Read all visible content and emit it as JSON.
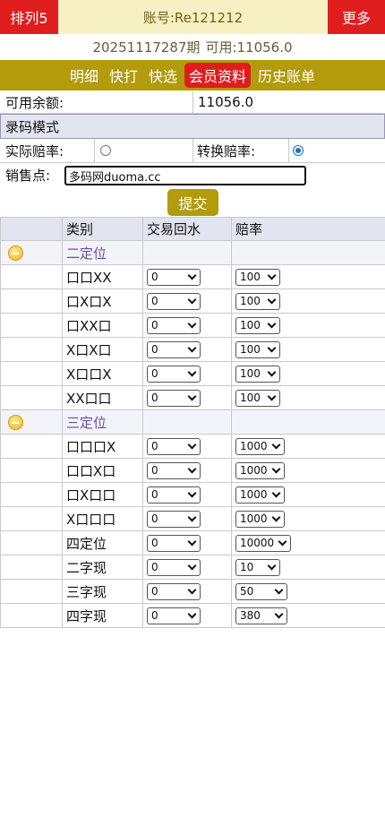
{
  "header": {
    "left_button": "排列5",
    "account": "账号:Re121212",
    "right_button": "更多"
  },
  "period": {
    "issue": "20251117287期",
    "available": "可用:11056.0"
  },
  "nav": {
    "items": [
      {
        "label": "明细"
      },
      {
        "label": "快打"
      },
      {
        "label": "快选"
      },
      {
        "label": "会员资料"
      },
      {
        "label": "历史账单"
      }
    ],
    "active_index": 3
  },
  "balance": {
    "label": "可用余额:",
    "value": "11056.0"
  },
  "mode": {
    "title": "录码模式",
    "actual_label": "实际赔率:",
    "convert_label": "转换赔率:",
    "selected": "convert"
  },
  "sale_point": {
    "label": "销售点:",
    "value": "多码网duoma.cc"
  },
  "submit_label": "提交",
  "table": {
    "headers": [
      "",
      "类别",
      "交易回水",
      "赔率"
    ],
    "groups": [
      {
        "title": "二定位",
        "rows": [
          {
            "category": "口口XX",
            "rebate": "0",
            "odds": "100"
          },
          {
            "category": "口X口X",
            "rebate": "0",
            "odds": "100"
          },
          {
            "category": "口XX口",
            "rebate": "0",
            "odds": "100"
          },
          {
            "category": "X口X口",
            "rebate": "0",
            "odds": "100"
          },
          {
            "category": "X口口X",
            "rebate": "0",
            "odds": "100"
          },
          {
            "category": "XX口口",
            "rebate": "0",
            "odds": "100"
          }
        ]
      },
      {
        "title": "三定位",
        "rows": [
          {
            "category": "口口口X",
            "rebate": "0",
            "odds": "1000"
          },
          {
            "category": "口口X口",
            "rebate": "0",
            "odds": "1000"
          },
          {
            "category": "口X口口",
            "rebate": "0",
            "odds": "1000"
          },
          {
            "category": "X口口口",
            "rebate": "0",
            "odds": "1000"
          },
          {
            "category": "四定位",
            "rebate": "0",
            "odds": "10000"
          },
          {
            "category": "二字现",
            "rebate": "0",
            "odds": "10"
          },
          {
            "category": "三字现",
            "rebate": "0",
            "odds": "50"
          },
          {
            "category": "四字现",
            "rebate": "0",
            "odds": "380"
          }
        ]
      }
    ]
  },
  "colors": {
    "red": "#e01d1d",
    "gold": "#b29b0c",
    "header_bg": "#f7f0c3",
    "table_head_bg": "#e2e4f0",
    "group_text": "#6a4c9c"
  }
}
